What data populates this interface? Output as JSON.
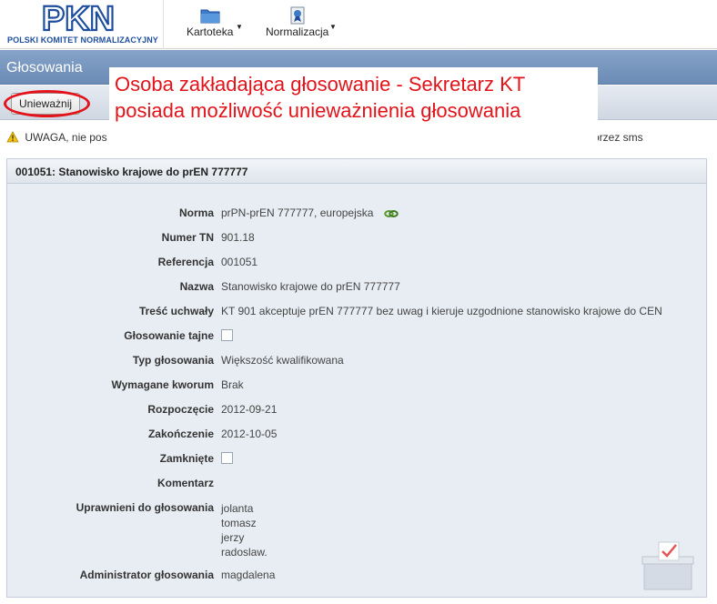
{
  "header": {
    "logo_text": "PKN",
    "logo_subtitle": "POLSKI KOMITET NORMALIZACYJNY",
    "menu": [
      {
        "label": "Kartoteka",
        "icon": "folder-icon"
      },
      {
        "label": "Normalizacja",
        "icon": "document-ribbon-icon"
      }
    ]
  },
  "page": {
    "title": "Głosowania",
    "toolbar": {
      "invalidate_label": "Unieważnij"
    },
    "warning_text": "UWAGA, nie pos",
    "warning_text_right": "przez sms"
  },
  "annotation": {
    "text": "Osoba zakładająca głosowanie - Sekretarz KT posiada możliwość unieważnienia głosowania",
    "color": "#e2131a"
  },
  "panel": {
    "heading": "001051: Stanowisko krajowe do prEN 777777",
    "fields": {
      "norma": {
        "label": "Norma",
        "value": "prPN-prEN 777777, europejska"
      },
      "numer_tn": {
        "label": "Numer TN",
        "value": "901.18"
      },
      "referencja": {
        "label": "Referencja",
        "value": "001051"
      },
      "nazwa": {
        "label": "Nazwa",
        "value": "Stanowisko krajowe do prEN 777777"
      },
      "tresc": {
        "label": "Treść uchwały",
        "value": "KT 901 akceptuje prEN 777777 bez uwag i kieruje uzgodnione stanowisko krajowe do CEN"
      },
      "tajne": {
        "label": "Głosowanie tajne",
        "checked": false
      },
      "typ": {
        "label": "Typ głosowania",
        "value": "Większość kwalifikowana"
      },
      "kworum": {
        "label": "Wymagane kworum",
        "value": "Brak"
      },
      "rozpoczecie": {
        "label": "Rozpoczęcie",
        "value": "2012-09-21"
      },
      "zakonczenie": {
        "label": "Zakończenie",
        "value": "2012-10-05"
      },
      "zamkniete": {
        "label": "Zamknięte",
        "checked": false
      },
      "komentarz": {
        "label": "Komentarz",
        "value": ""
      },
      "uprawnieni": {
        "label": "Uprawnieni do głosowania",
        "values": [
          "jolanta",
          "tomasz",
          "jerzy",
          "radoslaw."
        ]
      },
      "administrator": {
        "label": "Administrator głosowania",
        "value": "magdalena"
      }
    }
  },
  "colors": {
    "titlebar": "#7593bd",
    "accent_blue": "#1f4e9e",
    "annotation_red": "#e2131a"
  }
}
